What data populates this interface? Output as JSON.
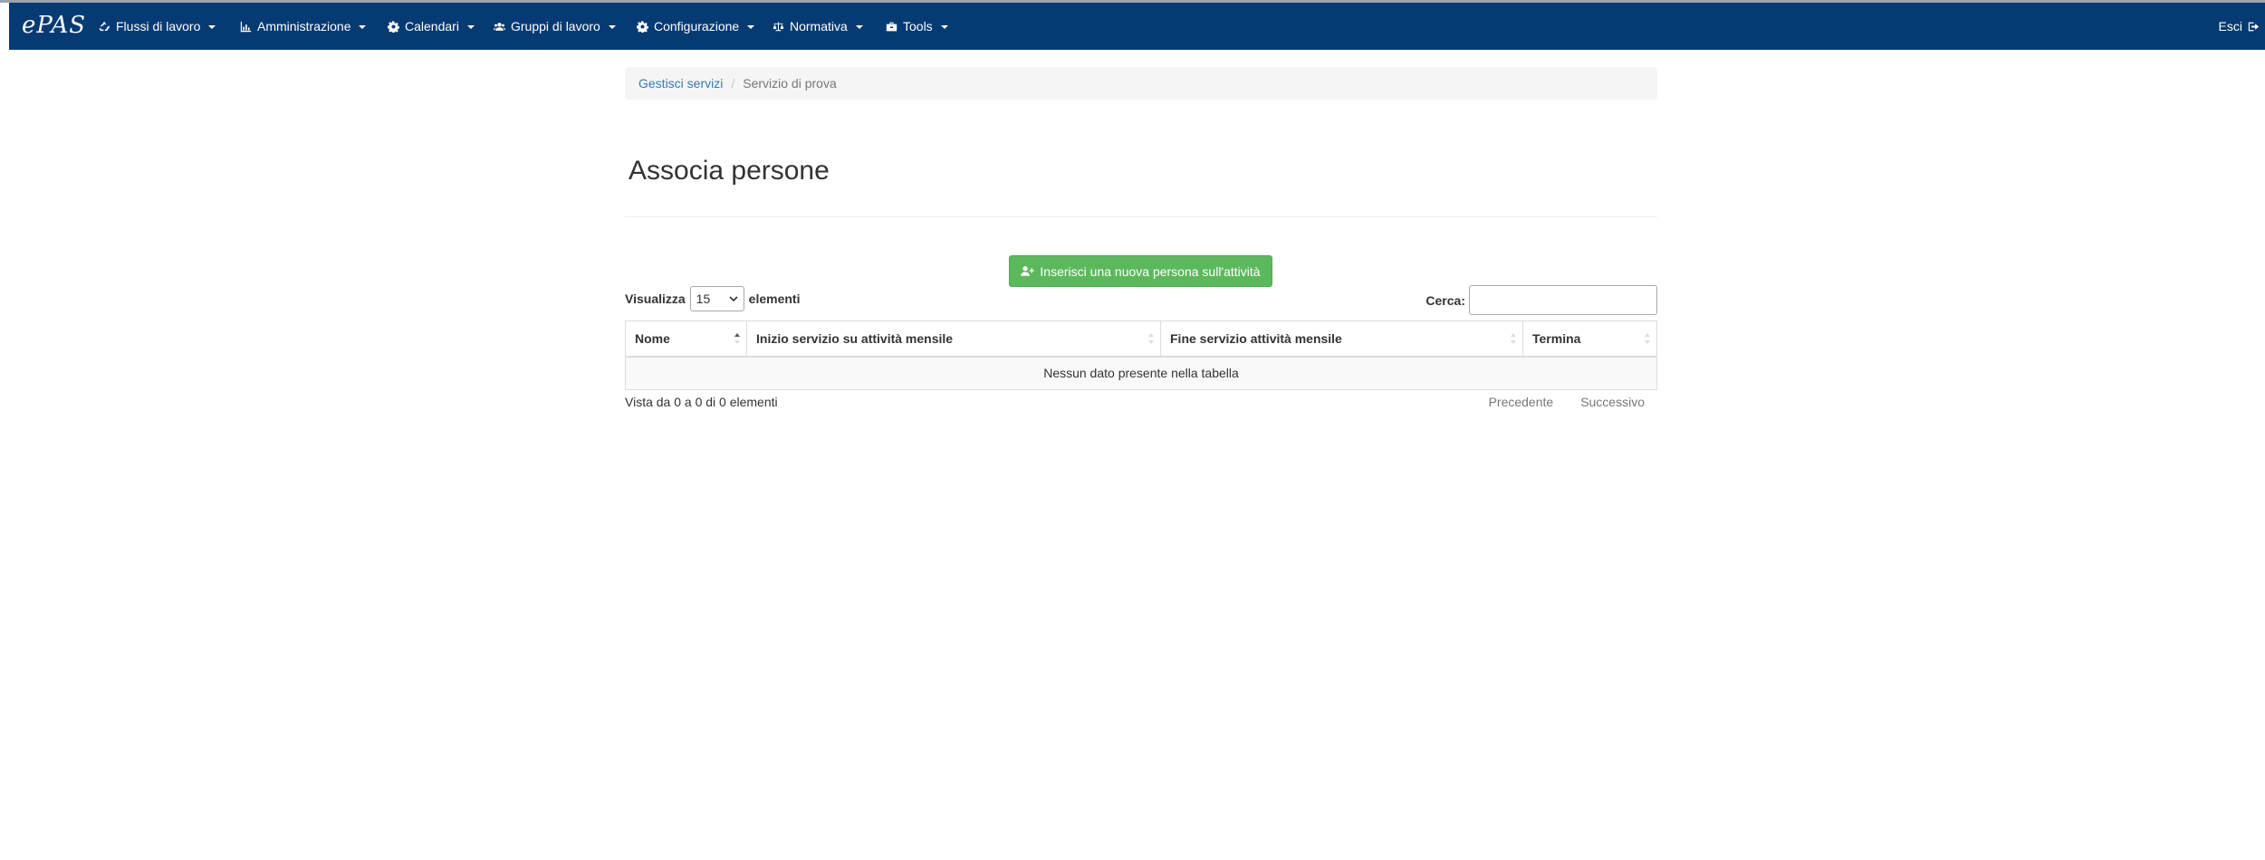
{
  "nav": {
    "brand": "ePAS",
    "items": [
      {
        "label": "Flussi di lavoro",
        "icon": "recycle-icon"
      },
      {
        "label": "Amministrazione",
        "icon": "bar-chart-icon"
      },
      {
        "label": "Calendari",
        "icon": "gear-icon"
      },
      {
        "label": "Gruppi di lavoro",
        "icon": "users-icon"
      },
      {
        "label": "Configurazione",
        "icon": "gear-icon"
      },
      {
        "label": "Normativa",
        "icon": "balance-scale-icon"
      },
      {
        "label": "Tools",
        "icon": "toolbox-icon"
      }
    ],
    "logout_label": "Esci",
    "colors": {
      "navbar": "#063a72"
    }
  },
  "breadcrumb": {
    "link": "Gestisci servizi",
    "separator": "/",
    "current": "Servizio di prova"
  },
  "page": {
    "title": "Associa persone"
  },
  "add_button": {
    "label": "Inserisci una nuova persona sull'attività",
    "icon": "user-plus-icon",
    "color": "#5cb85c"
  },
  "table": {
    "length_prefix": "Visualizza",
    "length_value": "15",
    "length_suffix": "elementi",
    "search_label": "Cerca:",
    "search_value": "",
    "columns": [
      "Nome",
      "Inizio servizio su attività mensile",
      "Fine servizio attività mensile",
      "Termina"
    ],
    "empty_message": "Nessun dato presente nella tabella",
    "info": "Vista da 0 a 0 di 0 elementi",
    "prev_label": "Precedente",
    "next_label": "Successivo"
  }
}
